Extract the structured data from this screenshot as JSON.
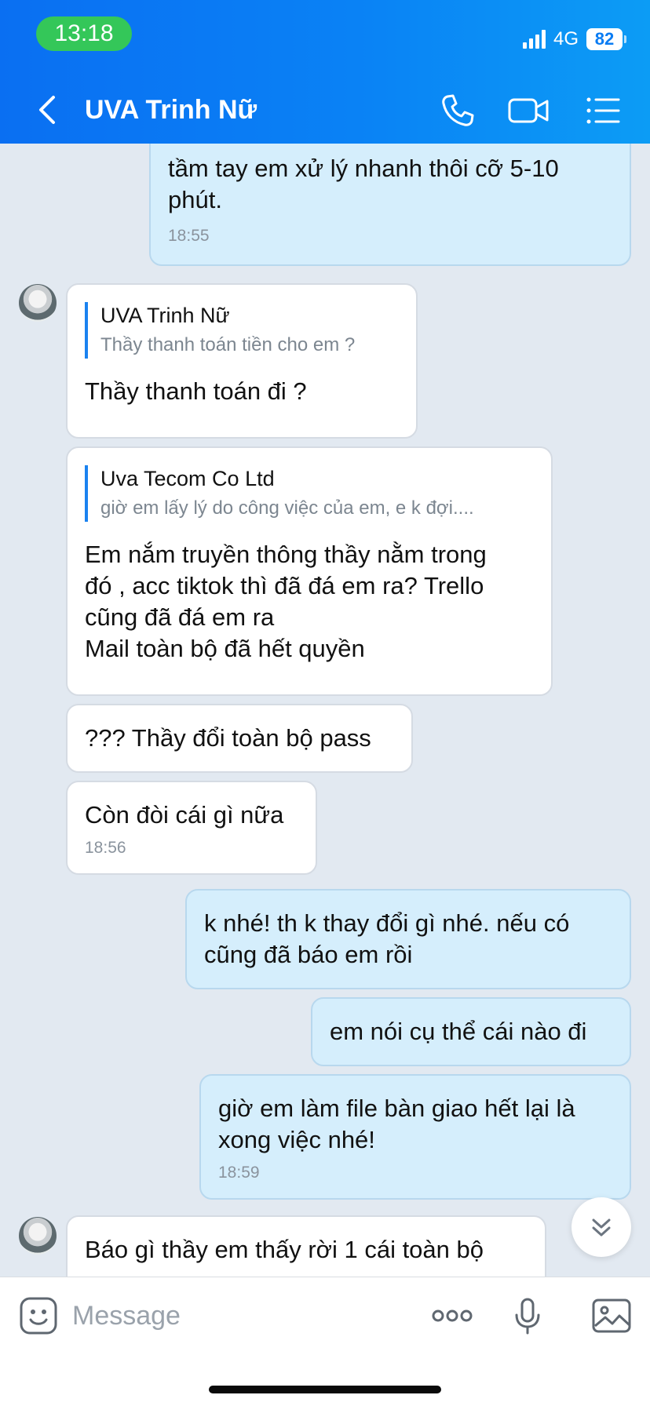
{
  "status_bar": {
    "time": "13:18",
    "network": "4G",
    "battery": "82"
  },
  "header": {
    "title": "UVA Trinh Nữ"
  },
  "messages": {
    "m1": {
      "text": "tầm tay em xử lý nhanh thôi cỡ 5-10\nphút.",
      "time": "18:55"
    },
    "m2": {
      "quote_name": "UVA Trinh Nữ",
      "quote_text": "Thầy thanh toán tiền cho em ?",
      "text": "Thầy thanh toán đi ?"
    },
    "m3": {
      "quote_name": "Uva Tecom Co Ltd",
      "quote_text": "giờ em lấy lý do công việc của em, e k đợi....",
      "text": "Em nắm truyền thông thầy nằm trong\nđó , acc tiktok thì đã đá em ra? Trello\ncũng đã đá em ra\nMail toàn bộ đã hết quyền"
    },
    "m4": {
      "text": "??? Thầy đổi toàn bộ pass"
    },
    "m5": {
      "text": "Còn đòi cái gì nữa",
      "time": "18:56"
    },
    "m6": {
      "text": "k nhé! th k thay đổi gì nhé. nếu có\ncũng đã báo em rồi"
    },
    "m7": {
      "text": "em nói cụ thể cái nào đi"
    },
    "m8": {
      "text": "giờ em làm file bàn giao hết lại là\nxong việc nhé!",
      "time": "18:59"
    },
    "m9": {
      "text": "Báo gì thầy em thấy rời 1 cái toàn bộ"
    }
  },
  "composer": {
    "placeholder": "Message"
  },
  "icons": [
    "back-icon",
    "phone-icon",
    "video-icon",
    "menu-icon",
    "chevrons-down-icon",
    "emoji-icon",
    "more-icon",
    "mic-icon",
    "image-icon"
  ],
  "colors": {
    "header_start": "#0a6ff2",
    "header_end": "#0c9cf5",
    "outgoing_bubble": "#d5eefc",
    "incoming_bubble": "#ffffff",
    "chat_bg": "#e2e9f1",
    "time_pill": "#34c759"
  }
}
